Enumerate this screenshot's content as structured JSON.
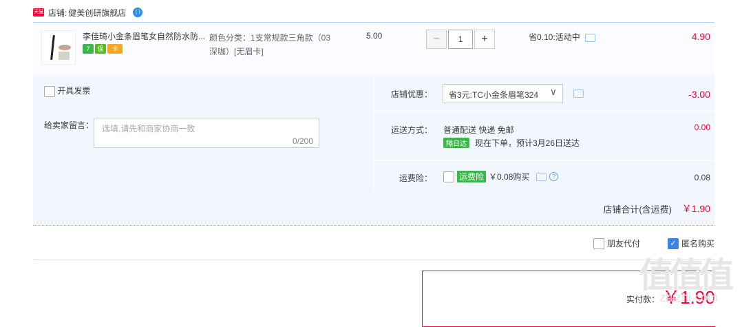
{
  "shop": {
    "tmall_tag": "天猫",
    "label": "店铺:",
    "name": "健美创研旗舰店",
    "wang": "(·)"
  },
  "item": {
    "title": "李佳琦小金条眉笔女自然防水防...",
    "sku_line1": "颜色分类：1支常规款三角款（03",
    "sku_line2": "深咖）[无眉卡]",
    "badges": [
      {
        "text": "7",
        "color": "#3cb64b"
      },
      {
        "text": "保",
        "color": "#5ab81e"
      },
      {
        "text": "卡",
        "color": "#f5a623"
      }
    ],
    "unit_price": "5.00",
    "quantity": "1",
    "minus": "−",
    "plus": "+",
    "promo": "省0.10:活动中",
    "subtotal": "4.90"
  },
  "invoice": {
    "label": "开具发票"
  },
  "message": {
    "label": "给卖家留言：",
    "placeholder": "选填,请先和商家协商一致",
    "count": "0/200"
  },
  "discount": {
    "label": "店铺优惠：",
    "selected": "省3元:TC小金条眉笔324",
    "amount": "-3.00"
  },
  "shipping": {
    "label": "运送方式：",
    "method": "普通配送 快递 免邮",
    "tag": "隔日达",
    "eta": "现在下单，预计3月26日送达",
    "amount": "0.00"
  },
  "insurance": {
    "label": "运费险：",
    "tag": "运费险",
    "price": "￥0.08购买",
    "amount": "0.08"
  },
  "shop_total": {
    "label": "店铺合计(含运费)",
    "amount": "￥1.90"
  },
  "options": {
    "friend_pay": "朋友代付",
    "anonymous": "匿名购买"
  },
  "payment": {
    "label": "实付款：",
    "amount": "￥1.90"
  },
  "watermark": {
    "text": "值值值",
    "sub": "zhizhi.com"
  },
  "colors": {
    "accent_red": "#ff0036",
    "panel_bg": "#f2f7ff",
    "border_blue": "#b2d1ff"
  }
}
